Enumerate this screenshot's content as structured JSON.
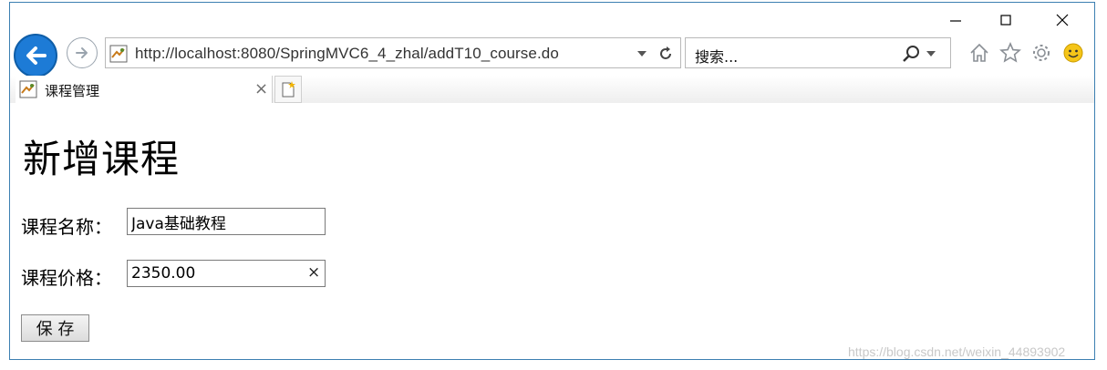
{
  "window": {
    "minimize_glyph": "—",
    "maximize_glyph": "☐",
    "close_glyph": "✕"
  },
  "toolbar": {
    "url": "http://localhost:8080/SpringMVC6_4_zhal/addT10_course.do",
    "search_placeholder": "搜索...",
    "icons": [
      "back-icon",
      "forward-icon",
      "refresh-icon",
      "search-icon",
      "home-icon",
      "star-icon",
      "gear-icon",
      "smiley-icon"
    ]
  },
  "tabs": [
    {
      "label": "课程管理",
      "close": "×"
    }
  ],
  "page": {
    "title": "新增课程",
    "fields": {
      "name_label": "课程名称：",
      "name_value": "Java基础教程",
      "price_label": "课程价格：",
      "price_value": "2350.00",
      "clear_glyph": "×"
    },
    "save_label": "保 存"
  },
  "watermark": "https://blog.csdn.net/weixin_44893902",
  "colors": {
    "accent": "#1d7bd6",
    "window_border": "#3c7fb1"
  }
}
